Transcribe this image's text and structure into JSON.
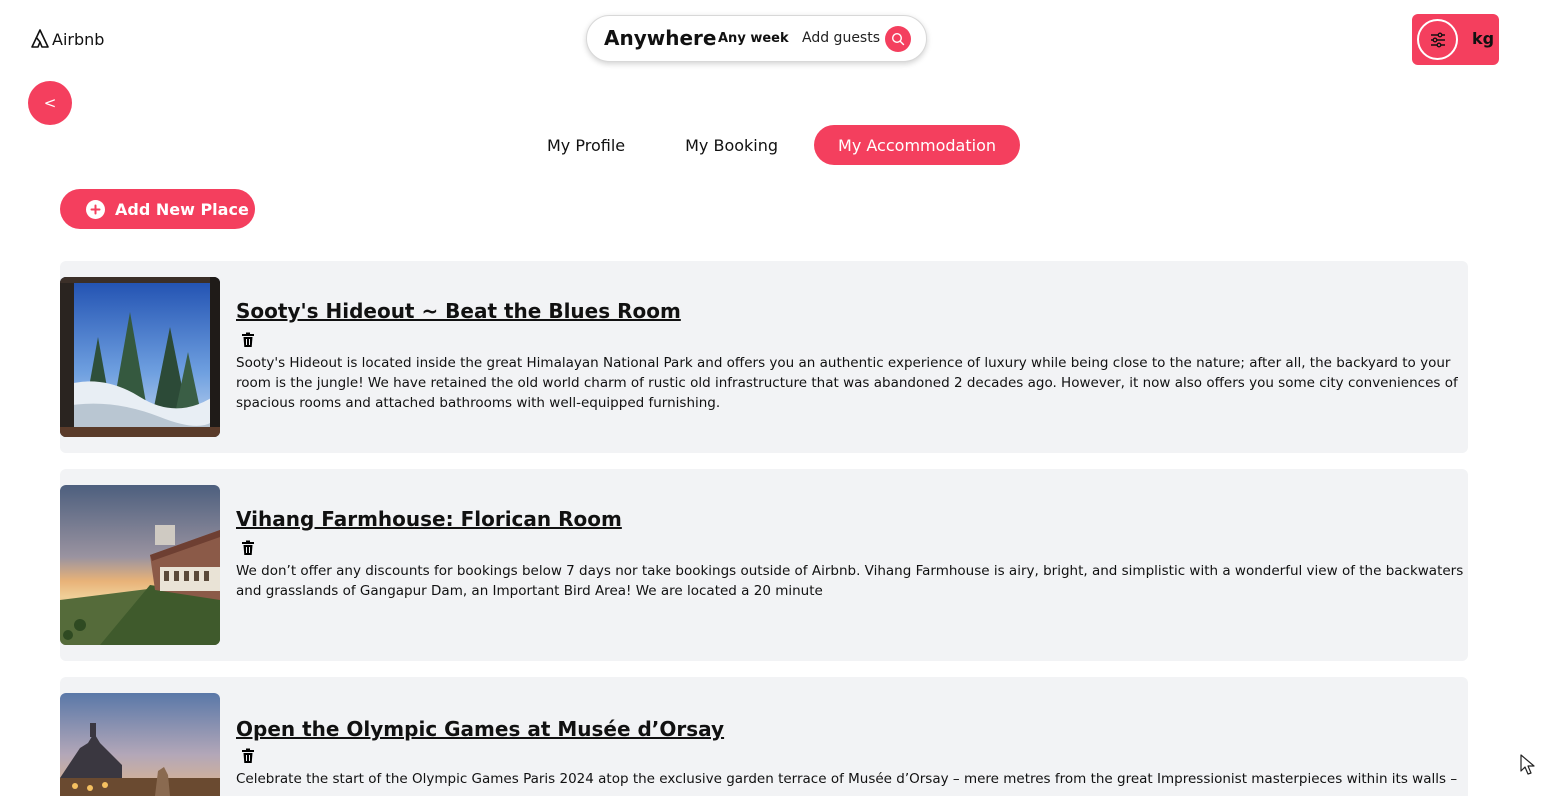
{
  "header": {
    "logo_text": "Airbnb",
    "search": {
      "location": "Anywhere",
      "week": "Any week",
      "guests": "Add guests"
    },
    "user": {
      "initials": "kg"
    }
  },
  "nav": {
    "back_label": "<",
    "tabs": [
      {
        "label": "My Profile",
        "active": false
      },
      {
        "label": "My Booking",
        "active": false
      },
      {
        "label": "My Accommodation",
        "active": true
      }
    ]
  },
  "actions": {
    "add_new_place": "Add New Place"
  },
  "listings": [
    {
      "title": "Sooty's Hideout ~ Beat the Blues Room",
      "description": "Sooty's Hideout is located inside the great Himalayan National Park and offers you an authentic experience of luxury while being close to the nature; after all, the backyard to your room is the jungle! We have retained the old world charm of rustic old infrastructure that was abandoned 2 decades ago. However, it now also offers you some city conveniences of spacious rooms and attached bathrooms with well-equipped furnishing."
    },
    {
      "title": "Vihang Farmhouse: Florican Room",
      "description": "We don’t offer any discounts for bookings below 7 days nor take bookings outside of Airbnb. Vihang Farmhouse is airy, bright, and simplistic with a wonderful view of the backwaters and grasslands of Gangapur Dam, an Important Bird Area! We are located a 20 minute"
    },
    {
      "title": "Open the Olympic Games at Musée d’Orsay",
      "description": "Celebrate the start of the Olympic Games Paris 2024 atop the exclusive garden terrace of Musée d’Orsay – mere metres from the great Impressionist masterpieces within its walls –"
    }
  ],
  "colors": {
    "accent": "#f43f5e",
    "card_bg": "#f2f3f5"
  }
}
